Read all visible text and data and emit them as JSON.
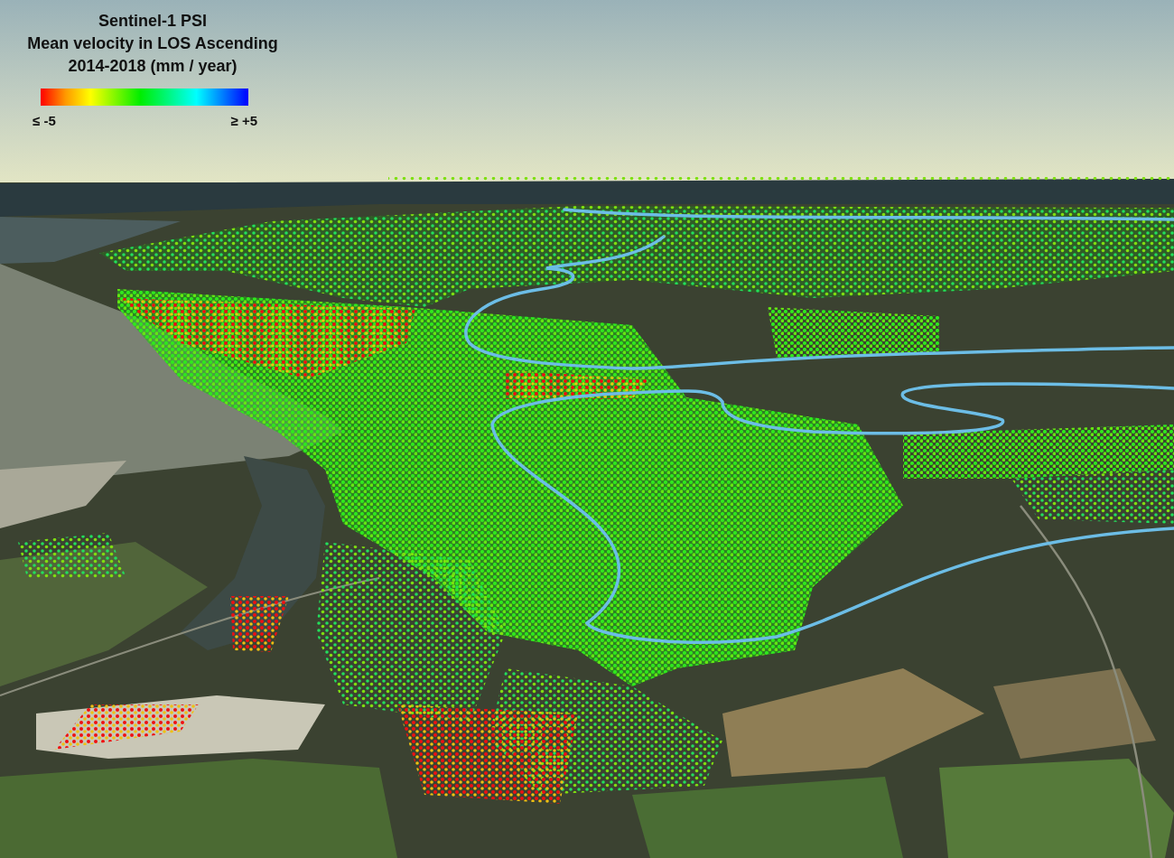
{
  "legend": {
    "title": "Sentinel-1 PSI",
    "subtitle": "Mean velocity in LOS Ascending",
    "units": "2014-2018 (mm / year)",
    "min_label": "≤ -5",
    "max_label": "≥ +5"
  }
}
